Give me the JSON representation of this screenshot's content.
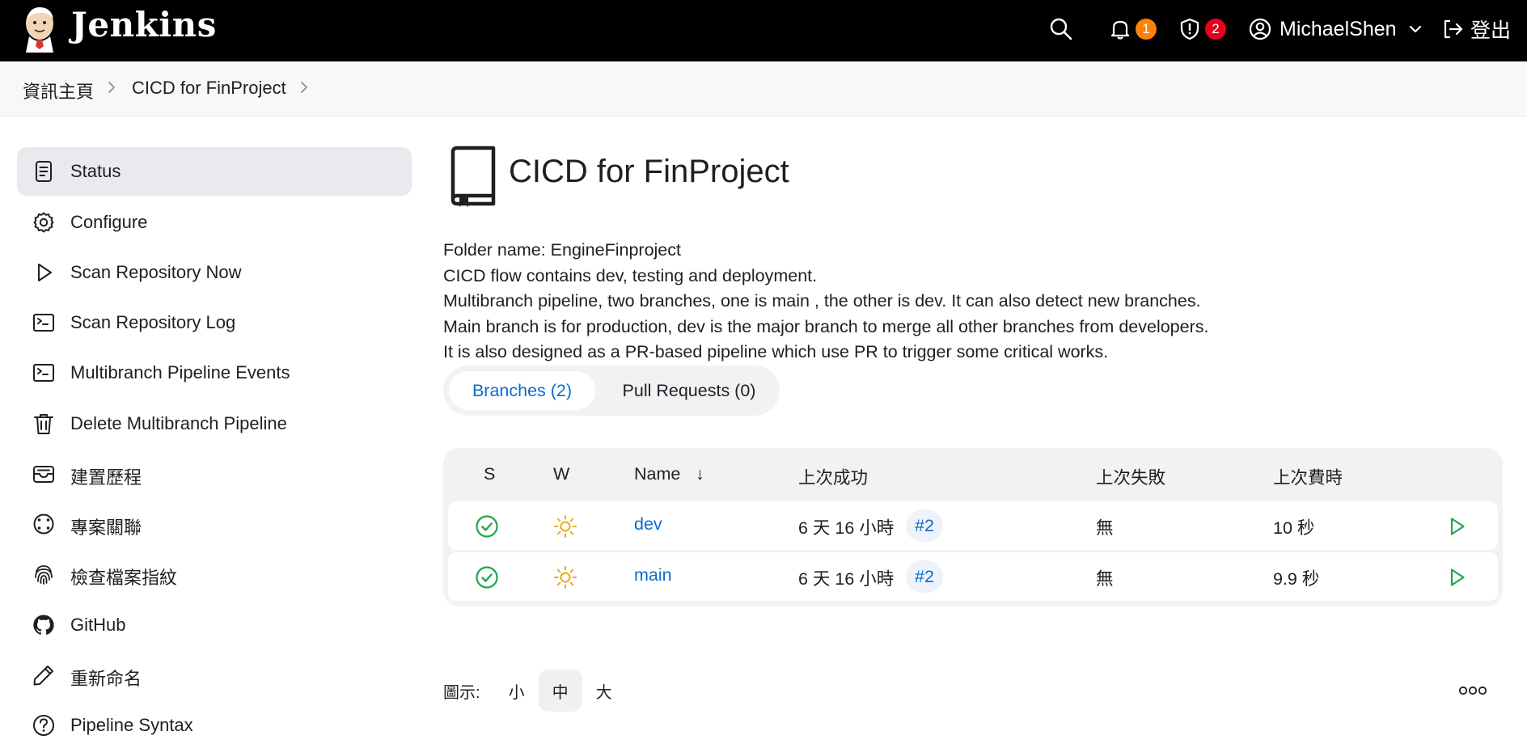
{
  "header": {
    "brand": "Jenkins",
    "notifications_count": "1",
    "security_count": "2",
    "username": "MichaelShen",
    "logout_label": "登出"
  },
  "breadcrumb": {
    "items": [
      "資訊主頁",
      "CICD for FinProject"
    ]
  },
  "sidebar": {
    "items": [
      {
        "label": "Status",
        "icon": "status-doc-icon"
      },
      {
        "label": "Configure",
        "icon": "gear-icon"
      },
      {
        "label": "Scan Repository Now",
        "icon": "play-icon"
      },
      {
        "label": "Scan Repository Log",
        "icon": "terminal-icon"
      },
      {
        "label": "Multibranch Pipeline Events",
        "icon": "terminal-icon"
      },
      {
        "label": "Delete Multibranch Pipeline",
        "icon": "trash-icon"
      },
      {
        "label": "建置歷程",
        "icon": "inbox-icon"
      },
      {
        "label": "專案關聯",
        "icon": "relations-icon"
      },
      {
        "label": "檢查檔案指紋",
        "icon": "fingerprint-icon"
      },
      {
        "label": "GitHub",
        "icon": "github-icon"
      },
      {
        "label": "重新命名",
        "icon": "pencil-icon"
      },
      {
        "label": "Pipeline Syntax",
        "icon": "help-icon"
      }
    ]
  },
  "main": {
    "title": "CICD for FinProject",
    "description": [
      "Folder name: EngineFinproject",
      "CICD flow contains dev, testing and deployment.",
      "Multibranch pipeline, two branches, one is main , the other is dev. It can also detect new branches.",
      "Main branch is for production, dev is the major branch to merge all other branches from developers.",
      "It is also designed as a PR-based pipeline which use PR to trigger some critical works."
    ],
    "tabs": [
      "Branches (2)",
      "Pull Requests (0)"
    ],
    "table": {
      "columns": [
        "S",
        "W",
        "Name",
        "↓",
        "上次成功",
        "上次失敗",
        "上次費時"
      ],
      "rows": [
        {
          "name": "dev",
          "last_success": "6 天 16 小時",
          "last_success_build": "#2",
          "last_failure": "無",
          "last_duration": "10 秒"
        },
        {
          "name": "main",
          "last_success": "6 天 16 小時",
          "last_success_build": "#2",
          "last_failure": "無",
          "last_duration": "9.9 秒"
        }
      ]
    },
    "icon_size": {
      "label": "圖示:",
      "options": [
        "小",
        "中",
        "大"
      ],
      "selected": "中"
    }
  },
  "colors": {
    "header_bg": "#000000",
    "link": "#0b6bcb",
    "success": "#1ea64b",
    "weather": "#f0a818",
    "badge_orange": "#fe820a",
    "badge_red": "#e6001f"
  }
}
